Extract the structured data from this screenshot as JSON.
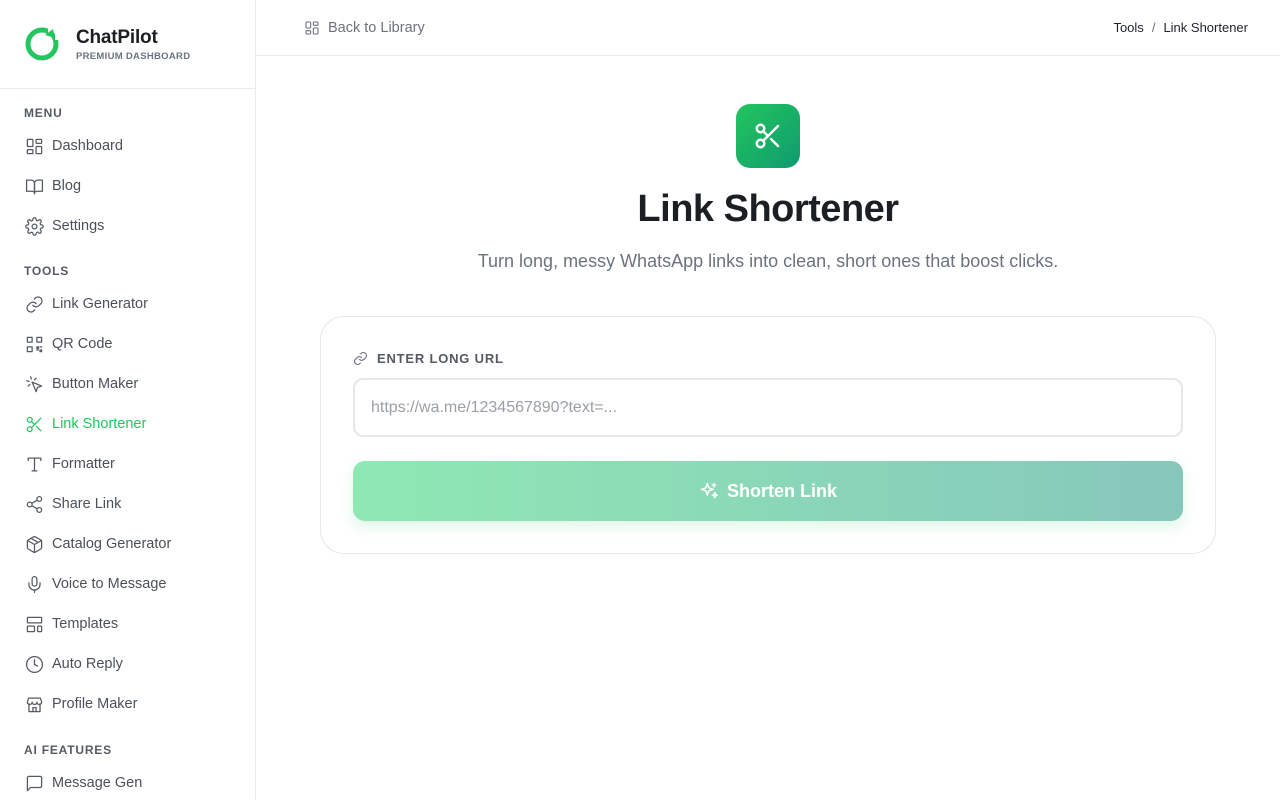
{
  "brand": {
    "name": "ChatPilot",
    "subtitle": "PREMIUM DASHBOARD",
    "accent": "#22c55e"
  },
  "sidebar": {
    "menu_title": "MENU",
    "menu": [
      {
        "label": "Dashboard",
        "icon": "dashboard-icon"
      },
      {
        "label": "Blog",
        "icon": "book-icon"
      },
      {
        "label": "Settings",
        "icon": "gear-icon"
      }
    ],
    "tools_title": "TOOLS",
    "tools": [
      {
        "label": "Link Generator",
        "icon": "link-icon"
      },
      {
        "label": "QR Code",
        "icon": "qr-code-icon"
      },
      {
        "label": "Button Maker",
        "icon": "cursor-click-icon"
      },
      {
        "label": "Link Shortener",
        "icon": "scissors-icon",
        "active": true
      },
      {
        "label": "Formatter",
        "icon": "type-icon"
      },
      {
        "label": "Share Link",
        "icon": "share-icon"
      },
      {
        "label": "Catalog Generator",
        "icon": "package-icon"
      },
      {
        "label": "Voice to Message",
        "icon": "microphone-icon"
      },
      {
        "label": "Templates",
        "icon": "layout-icon"
      },
      {
        "label": "Auto Reply",
        "icon": "clock-icon"
      },
      {
        "label": "Profile Maker",
        "icon": "store-icon"
      }
    ],
    "ai_title": "AI FEATURES",
    "ai": [
      {
        "label": "Message Gen",
        "icon": "message-square-icon"
      }
    ]
  },
  "topbar": {
    "back_label": "Back to Library",
    "breadcrumb": [
      "Tools",
      "Link Shortener"
    ],
    "breadcrumb_sep": "/"
  },
  "main": {
    "title": "Link Shortener",
    "subtitle": "Turn long, messy WhatsApp links into clean, short ones that boost clicks.",
    "field_label": "ENTER LONG URL",
    "input_value": "",
    "input_placeholder": "https://wa.me/1234567890?text=...",
    "button_label": "Shorten Link"
  }
}
